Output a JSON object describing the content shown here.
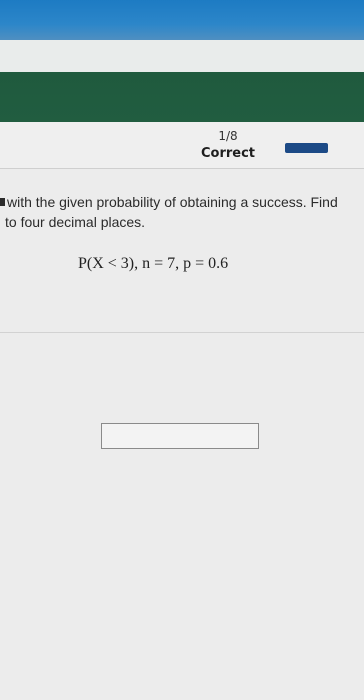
{
  "progress": {
    "count": "1/8",
    "status": "Correct"
  },
  "question": {
    "line1": "with the given probability of obtaining a success. Find",
    "line2": "to four decimal places."
  },
  "formula": "P(X < 3), n = 7, p = 0.6",
  "answer": {
    "value": ""
  },
  "colors": {
    "top_strip": "#2c86c9",
    "green_bar": "#215d40",
    "progress_fill": "#1c4a86"
  }
}
